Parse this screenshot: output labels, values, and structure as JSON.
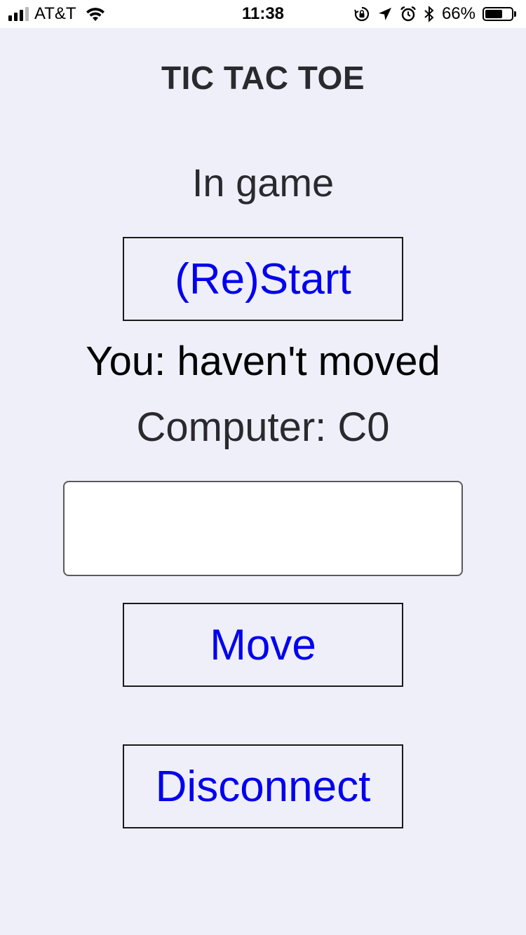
{
  "status_bar": {
    "carrier": "AT&T",
    "time": "11:38",
    "battery_percent_label": "66%",
    "battery_level": 0.66,
    "signal_bars_filled": 3,
    "signal_bars_total": 4,
    "icons": [
      "wifi-icon",
      "orientation-lock-icon",
      "location-arrow-icon",
      "alarm-icon",
      "bluetooth-icon",
      "battery-icon"
    ]
  },
  "app": {
    "title": "TIC TAC TOE",
    "game_state": "In game",
    "restart_label": "(Re)Start",
    "you_status": "You: haven't moved",
    "computer_status": "Computer: C0",
    "move_input": {
      "value": "",
      "placeholder": ""
    },
    "move_label": "Move",
    "disconnect_label": "Disconnect"
  },
  "colors": {
    "background": "#efeffa",
    "link_blue": "#0000ee",
    "text_dark": "#2a2a2e"
  }
}
